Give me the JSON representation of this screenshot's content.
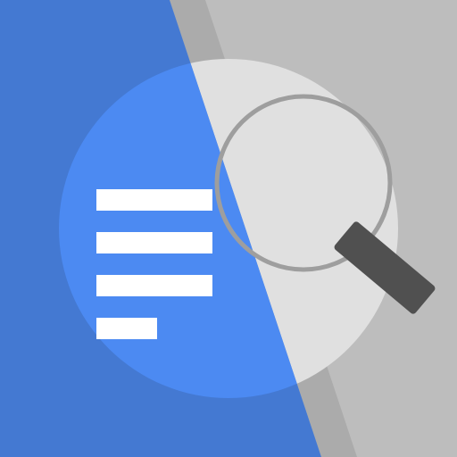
{
  "app_icon": {
    "name": "document-search-app-icon",
    "colors": {
      "blue_background": "#4479D2",
      "blue_circle": "#4C8AF2",
      "gray_background": "#BDBDBD",
      "gray_circle": "#E0E0E0",
      "diagonal_band": "#ABABAB",
      "text_lines": "#FFFFFF",
      "magnifier_ring": "#9E9E9E",
      "magnifier_handle": "#505050"
    },
    "icons": [
      "document-lines-icon",
      "magnifying-glass-icon"
    ]
  }
}
